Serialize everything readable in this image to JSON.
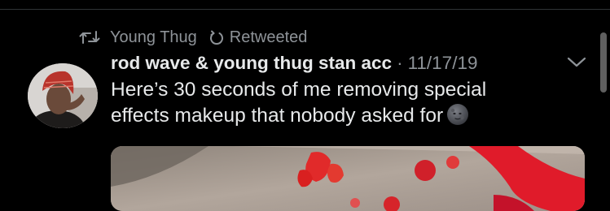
{
  "retweet": {
    "retweeter_name": "Young Thug",
    "status_label": "Retweeted",
    "icon": "retweet-icon",
    "status_icon": "undo-icon"
  },
  "tweet": {
    "author_name": "rod wave & young thug stan acc",
    "separator": "·",
    "date": "11/17/19",
    "text_line_1": "Here’s 30 seconds of me removing special",
    "text_line_2": "effects makeup that nobody asked for",
    "emoji": "new-moon-face-emoji",
    "menu_icon": "chevron-down-icon"
  },
  "colors": {
    "background": "#000000",
    "primary_text": "#e7e9ea",
    "secondary_text": "#8e9398"
  }
}
